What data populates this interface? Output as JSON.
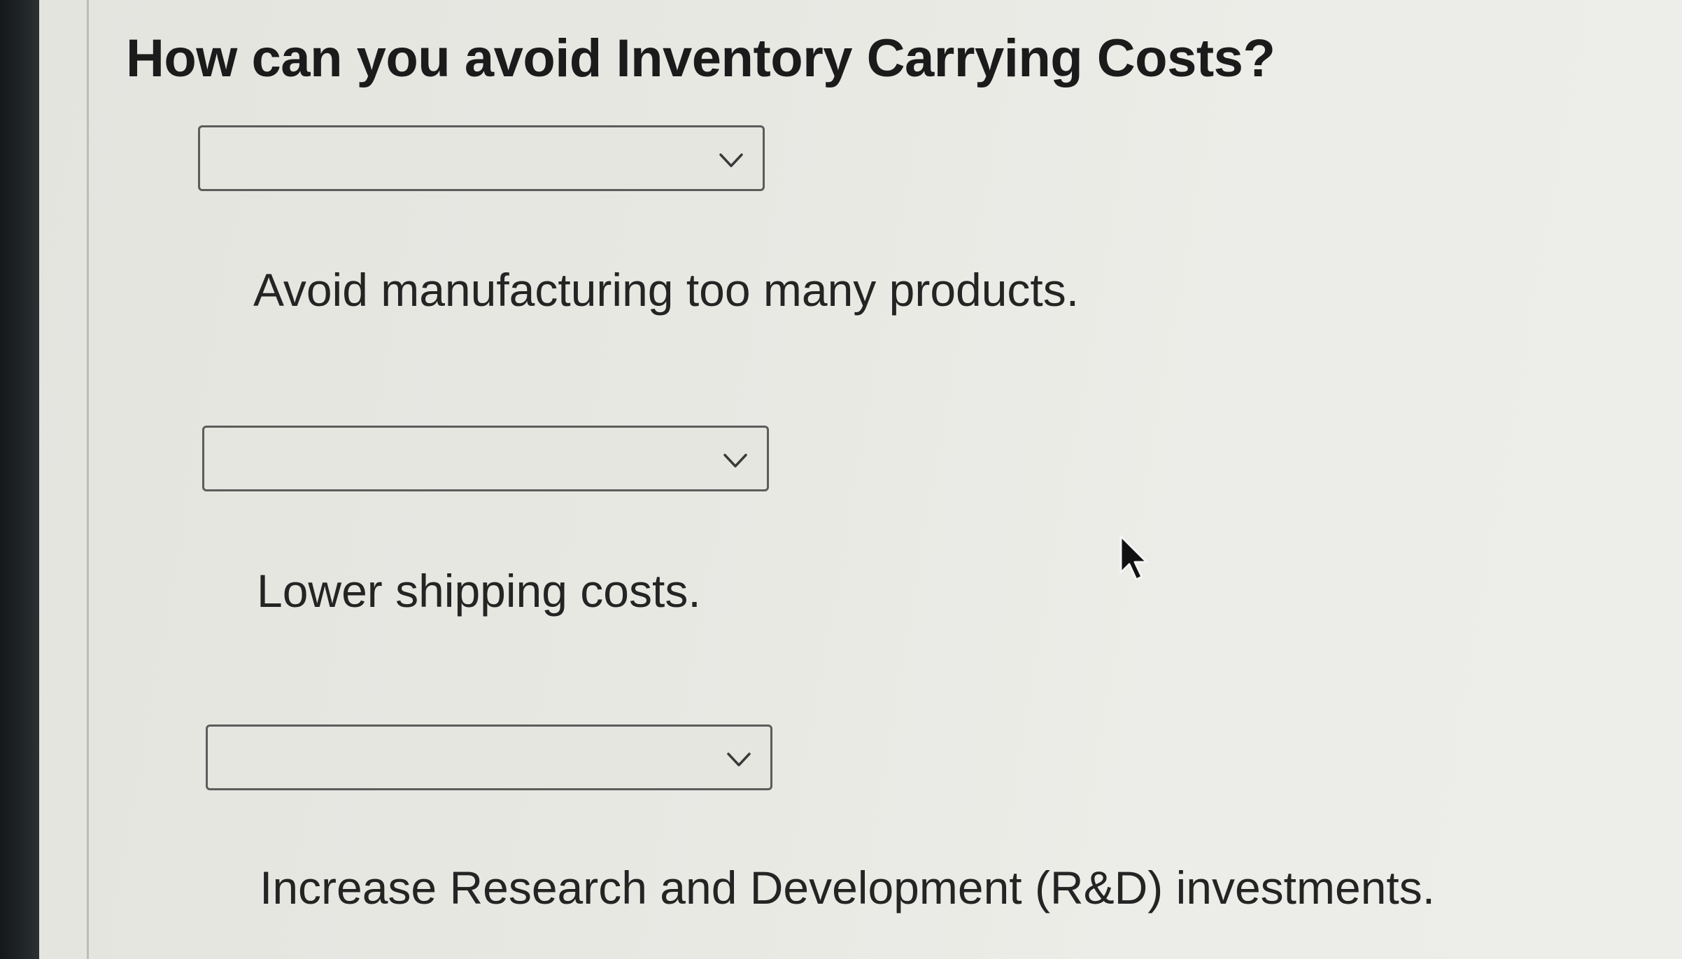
{
  "question": {
    "title": "How can you avoid Inventory Carrying Costs?"
  },
  "items": [
    {
      "selected": "",
      "text": "Avoid manufacturing too many products."
    },
    {
      "selected": "",
      "text": "Lower shipping costs."
    },
    {
      "selected": "",
      "text": "Increase Research and Development (R&D) investments."
    }
  ],
  "icons": {
    "dropdown": "chevron-down-icon",
    "pointer": "mouse-cursor-icon"
  },
  "colors": {
    "background": "#e8e8e3",
    "text": "#1b1b1b",
    "select_border": "#5c5c5c"
  }
}
